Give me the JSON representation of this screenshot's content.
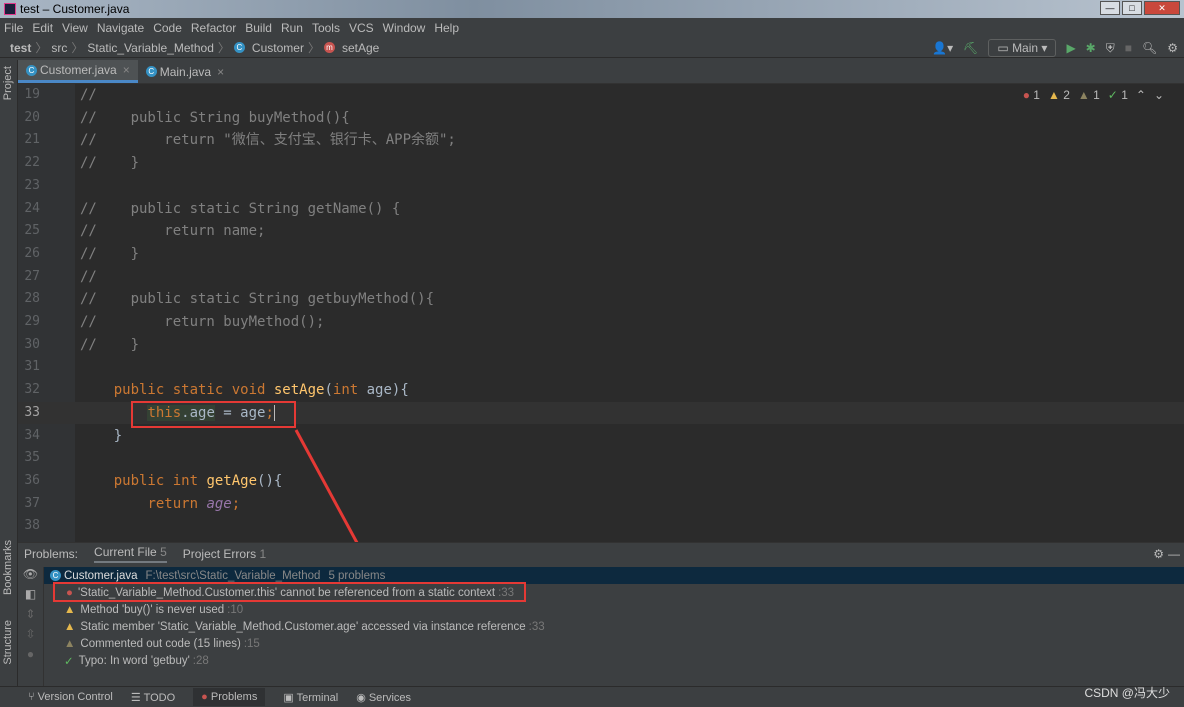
{
  "window": {
    "title": "test – Customer.java"
  },
  "menu": [
    "File",
    "Edit",
    "View",
    "Navigate",
    "Code",
    "Refactor",
    "Build",
    "Run",
    "Tools",
    "VCS",
    "Window",
    "Help"
  ],
  "breadcrumb": [
    "test",
    "src",
    "Static_Variable_Method",
    "Customer",
    "setAge"
  ],
  "toolbar": {
    "run_config": "Main"
  },
  "side_labels": {
    "project": "Project",
    "bookmarks": "Bookmarks",
    "structure": "Structure"
  },
  "tabs": [
    {
      "label": "Customer.java",
      "active": true
    },
    {
      "label": "Main.java",
      "active": false
    }
  ],
  "inspections": {
    "errors": "1",
    "warnings": "2",
    "weak_warnings": "1",
    "typos": "1"
  },
  "code_lines": [
    {
      "n": "19",
      "t": [
        [
          "//",
          "c"
        ]
      ]
    },
    {
      "n": "20",
      "t": [
        [
          "//    public String buyMethod(){",
          "c"
        ]
      ]
    },
    {
      "n": "21",
      "t": [
        [
          "//        return \"微信、支付宝、银行卡、APP余额\";",
          "c"
        ]
      ]
    },
    {
      "n": "22",
      "t": [
        [
          "//    }",
          "c"
        ]
      ]
    },
    {
      "n": "23",
      "t": []
    },
    {
      "n": "24",
      "t": [
        [
          "//    public static String getName() {",
          "c"
        ]
      ]
    },
    {
      "n": "25",
      "t": [
        [
          "//        return name;",
          "c"
        ]
      ]
    },
    {
      "n": "26",
      "t": [
        [
          "//    }",
          "c"
        ]
      ]
    },
    {
      "n": "27",
      "t": [
        [
          "//",
          "c"
        ]
      ]
    },
    {
      "n": "28",
      "t": [
        [
          "//    public static String getbuyMethod(){",
          "c"
        ]
      ]
    },
    {
      "n": "29",
      "t": [
        [
          "//        return buyMethod();",
          "c"
        ]
      ]
    },
    {
      "n": "30",
      "t": [
        [
          "//    }",
          "c"
        ]
      ]
    },
    {
      "n": "31",
      "t": []
    },
    {
      "n": "32",
      "t": [
        [
          "    ",
          ""
        ],
        [
          "public static void ",
          "k"
        ],
        [
          "setAge",
          "f"
        ],
        [
          "(",
          ""
        ],
        [
          "int ",
          "k"
        ],
        [
          "age){",
          ""
        ]
      ]
    },
    {
      "n": "33",
      "t": [
        [
          "        ",
          ""
        ],
        [
          "this",
          "k hl"
        ],
        [
          ".age",
          "hl"
        ],
        [
          " = age",
          ""
        ],
        [
          ";",
          "k"
        ]
      ],
      "current": true
    },
    {
      "n": "34",
      "t": [
        [
          "    }",
          ""
        ]
      ]
    },
    {
      "n": "35",
      "t": []
    },
    {
      "n": "36",
      "t": [
        [
          "    ",
          ""
        ],
        [
          "public int ",
          "k"
        ],
        [
          "getAge",
          "f"
        ],
        [
          "(){",
          ""
        ]
      ]
    },
    {
      "n": "37",
      "t": [
        [
          "        ",
          ""
        ],
        [
          "return ",
          "k"
        ],
        [
          "age",
          "i"
        ],
        [
          ";",
          "k"
        ]
      ]
    },
    {
      "n": "38",
      "t": []
    }
  ],
  "problems": {
    "label": "Problems:",
    "tabs": [
      {
        "label": "Current File",
        "count": "5"
      },
      {
        "label": "Project Errors",
        "count": "1"
      }
    ],
    "file": {
      "name": "Customer.java",
      "path": "F:\\test\\src\\Static_Variable_Method",
      "summary": "5 problems"
    },
    "items": [
      {
        "severity": "error",
        "text": "'Static_Variable_Method.Customer.this' cannot be referenced from a static context",
        "line": ":33"
      },
      {
        "severity": "warning",
        "text": "Method 'buy()' is never used",
        "line": ":10"
      },
      {
        "severity": "warning",
        "text": "Static member 'Static_Variable_Method.Customer.age' accessed via instance reference",
        "line": ":33"
      },
      {
        "severity": "weak",
        "text": "Commented out code (15 lines)",
        "line": ":15"
      },
      {
        "severity": "typo",
        "text": "Typo: In word 'getbuy'",
        "line": ":28"
      }
    ]
  },
  "statusbar": [
    {
      "label": "Version Control",
      "icon": "branch-icon"
    },
    {
      "label": "TODO",
      "icon": "list-icon"
    },
    {
      "label": "Problems",
      "icon": "error-icon",
      "active": true
    },
    {
      "label": "Terminal",
      "icon": "terminal-icon"
    },
    {
      "label": "Services",
      "icon": "services-icon"
    }
  ],
  "watermark": "CSDN @冯大少",
  "colors": {
    "accent": "#4a88c7",
    "error": "#c75450",
    "annotation": "#e53935"
  }
}
